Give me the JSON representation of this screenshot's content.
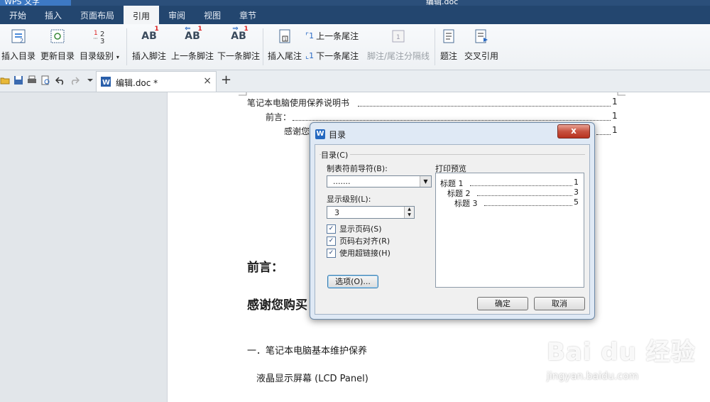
{
  "app": {
    "name": "WPS 文字",
    "window_title": "编辑.doc"
  },
  "menu": [
    "开始",
    "插入",
    "页面布局",
    "引用",
    "审阅",
    "视图",
    "章节"
  ],
  "menu_active": "引用",
  "ribbon": {
    "insert_toc": "插入目录",
    "update_toc": "更新目录",
    "toc_level": "目录级别",
    "insert_footnote": "插入脚注",
    "prev_footnote": "上一条脚注",
    "next_footnote": "下一条脚注",
    "insert_endnote": "插入尾注",
    "prev_endnote": "上一条尾注",
    "next_endnote": "下一条尾注",
    "separator": "脚注/尾注分隔线",
    "caption": "题注",
    "cross_ref": "交叉引用"
  },
  "tab": {
    "name": "编辑.doc *",
    "close": "×",
    "new": "+"
  },
  "document": {
    "toc": [
      {
        "text": "笔记本电脑使用保养说明书",
        "page": "1"
      },
      {
        "text": "前言：",
        "page": "1"
      },
      {
        "text": "感谢您",
        "page": "1"
      }
    ],
    "heading1": "前言：",
    "heading2": "感谢您购买",
    "section1": "一．笔记本电脑基本维护保养",
    "subsection": "液晶显示屏幕 (LCD Panel)"
  },
  "dialog": {
    "title": "目录",
    "close": "x",
    "group_label": "目录(C)",
    "leader_label": "制表符前导符(B):",
    "leader_value": ".......",
    "level_label": "显示级别(L):",
    "level_value": "3",
    "checks": [
      {
        "label": "显示页码(S)",
        "checked": true
      },
      {
        "label": "页码右对齐(R)",
        "checked": true
      },
      {
        "label": "使用超链接(H)",
        "checked": true
      }
    ],
    "options_button": "选项(O)...",
    "preview_label": "打印预览",
    "preview": [
      {
        "label": "标题 1",
        "page": "1"
      },
      {
        "label": "标题 2",
        "page": "3"
      },
      {
        "label": "标题 3",
        "page": "5"
      }
    ],
    "ok": "确定",
    "cancel": "取消"
  },
  "watermark": {
    "main": "Bai du 经验",
    "sub": "jingyan.baidu.com"
  },
  "colors": {
    "menubar": "#23466f",
    "accent": "#3d79c4",
    "dialog_frame": "#dfe9f5"
  }
}
